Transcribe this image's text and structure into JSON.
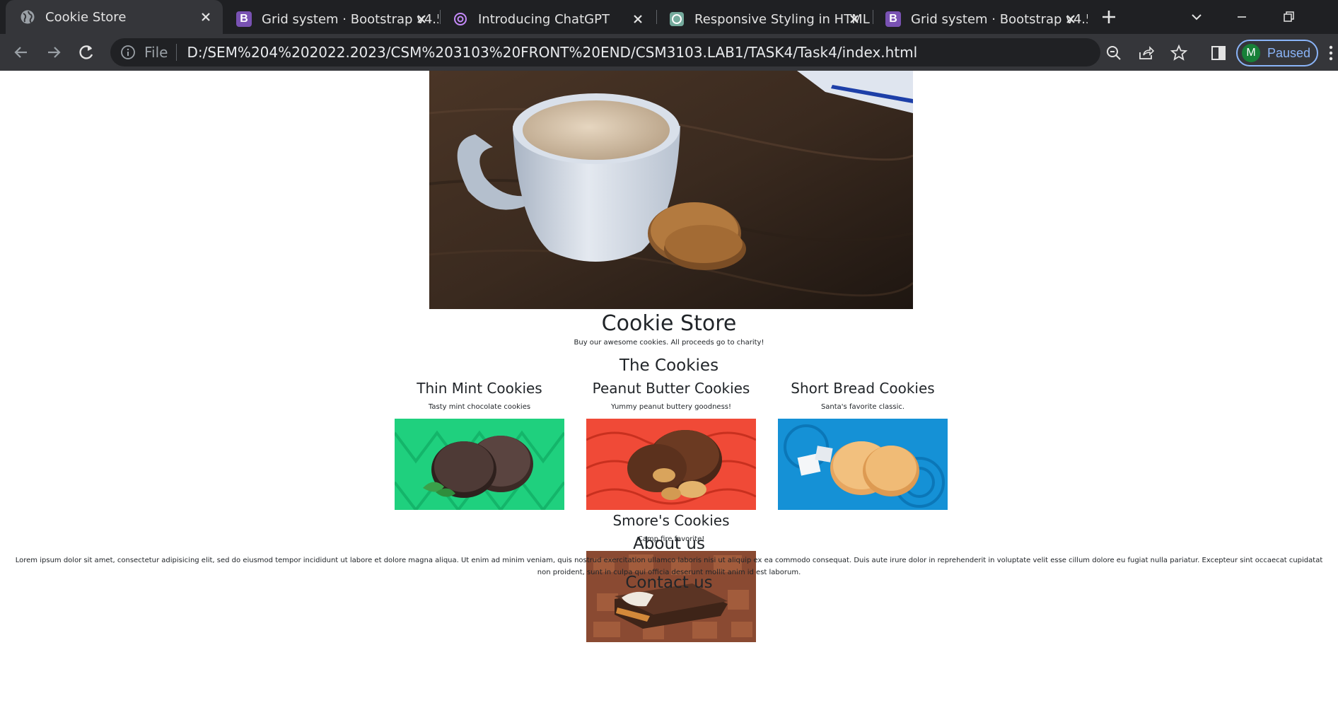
{
  "browser": {
    "tabs": [
      {
        "title": "Cookie Store",
        "active": true,
        "icon": "globe-icon"
      },
      {
        "title": "Grid system · Bootstrap v4.5",
        "active": false,
        "icon": "bootstrap-icon"
      },
      {
        "title": "Introducing ChatGPT",
        "active": false,
        "icon": "openai-icon"
      },
      {
        "title": "Responsive Styling in HTML",
        "active": false,
        "icon": "chatgpt-icon"
      },
      {
        "title": "Grid system · Bootstrap v4.5",
        "active": false,
        "icon": "bootstrap-icon"
      }
    ],
    "favicon_letter": "B",
    "address": {
      "scheme": "File",
      "url": "D:/SEM%204%202022.2023/CSM%203103%20FRONT%20END/CSM3103.LAB1/TASK4/Task4/index.html"
    },
    "profile": {
      "initial": "M",
      "label": "Paused"
    },
    "colors": {
      "tabbar": "#1f2023",
      "toolbar": "#35363a",
      "omnibox": "#202124",
      "profile_accent": "#8ab4f8",
      "bootstrap_purple": "#7952b3"
    }
  },
  "page": {
    "site_title": "Cookie Store",
    "tagline": "Buy our awesome cookies. All proceeds go to charity!",
    "cookies_heading": "The Cookies",
    "cookies": [
      {
        "name": "Thin Mint Cookies",
        "description": "Tasty mint chocolate cookies",
        "bg_color": "#1fd07e"
      },
      {
        "name": "Peanut Butter Cookies",
        "description": "Yummy peanut buttery goodness!",
        "bg_color": "#f04a37"
      },
      {
        "name": "Short Bread Cookies",
        "description": "Santa's favorite classic.",
        "bg_color": "#1591d6"
      },
      {
        "name": "Smore's Cookies",
        "description": "Camp fire favorite!",
        "bg_color": "#8a4a32"
      }
    ],
    "about_heading": "About us",
    "about_text": "Lorem ipsum dolor sit amet, consectetur adipisicing elit, sed do eiusmod tempor incididunt ut labore et dolore magna aliqua. Ut enim ad minim veniam, quis nostrud exercitation ullamco laboris nisi ut aliquip ex ea commodo consequat. Duis aute irure dolor in reprehenderit in voluptate velit esse cillum dolore eu fugiat nulla pariatur. Excepteur sint occaecat cupidatat non proident, sunt in culpa qui officia deserunt mollit anim id est laborum.",
    "contact_heading": "Contact us"
  }
}
